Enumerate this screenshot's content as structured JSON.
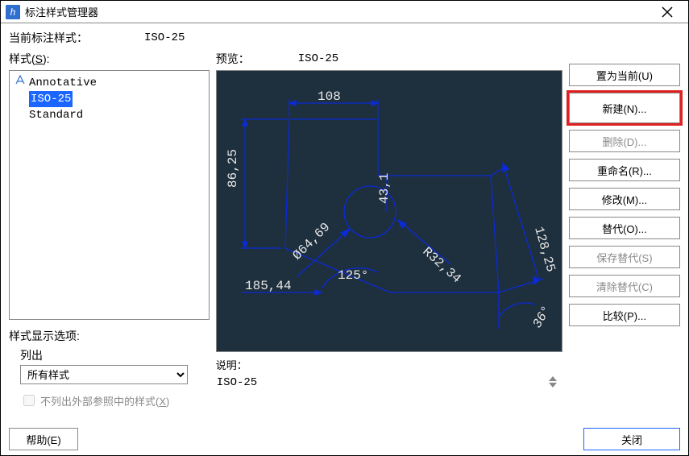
{
  "window": {
    "title": "标注样式管理器",
    "app_icon_letter": "h"
  },
  "current_style": {
    "label": "当前标注样式：",
    "value": "ISO-25"
  },
  "styles_label": "样式(",
  "styles_label_u": "S",
  "styles_label_tail": "):",
  "style_list": {
    "items": [
      "Annotative",
      "ISO-25",
      "Standard"
    ],
    "selected_index": 1
  },
  "list_opts_label": "样式显示选项:",
  "list_out_label": "列出",
  "list_select_value": "所有样式",
  "chk_label_pre": "不列出外部参照中的样式(",
  "chk_label_u": "X",
  "chk_label_tail": ")",
  "preview_label": "预览：",
  "preview_value": "ISO-25",
  "preview_dims": {
    "d108": "108",
    "d8625": "86,25",
    "d6469": "Ø64,69",
    "a125": "125°",
    "d18544": "185,44",
    "d431": "43,1",
    "r3234": "R32,34",
    "d12825": "128,25",
    "a36": "36°"
  },
  "desc_label": "说明：",
  "desc_value": "ISO-25",
  "buttons": {
    "set_current": "置为当前(U)",
    "new": "新建(N)...",
    "delete": "删除(D)...",
    "rename": "重命名(R)...",
    "modify": "修改(M)...",
    "override": "替代(O)...",
    "save_override": "保存替代(S)",
    "clear_override": "清除替代(C)",
    "compare": "比较(P)..."
  },
  "help_btn": "帮助(E)",
  "close_btn": "关闭"
}
